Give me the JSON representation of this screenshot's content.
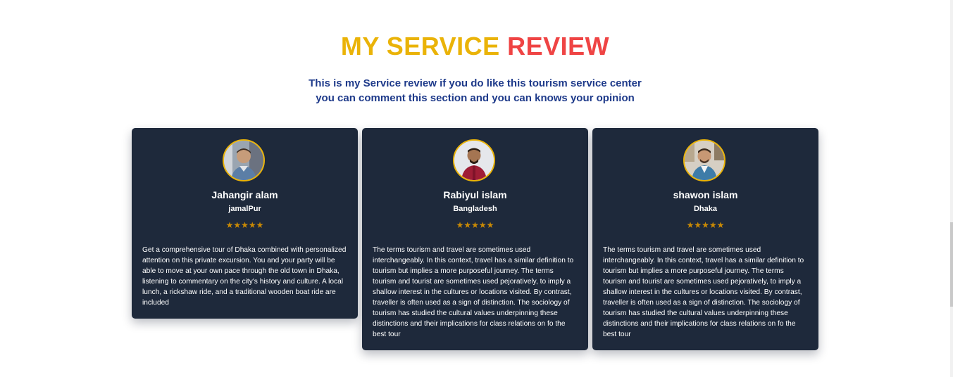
{
  "section": {
    "title_part1": "MY SERVICE",
    "title_part2": "REVIEW",
    "subtitle_line1": "This is my Service review if you do like this tourism service center",
    "subtitle_line2": "you can comment this section and you can knows your opinion"
  },
  "colors": {
    "title_accent_yellow": "#eab308",
    "title_accent_red": "#ef4444",
    "subtitle": "#1e3a8a",
    "card_background": "#1e293b",
    "star": "#ca8a04"
  },
  "reviews": [
    {
      "name": "Jahangir alam",
      "location": "jamalPur",
      "rating": 5,
      "stars": "★★★★★",
      "text": "Get a comprehensive tour of Dhaka combined with personalized attention on this private excursion. You and your party will be able to move at your own pace through the old town in Dhaka, listening to commentary on the city's history and culture. A local lunch, a rickshaw ride, and a traditional wooden boat ride are included"
    },
    {
      "name": "Rabiyul islam",
      "location": "Bangladesh",
      "rating": 5,
      "stars": "★★★★★",
      "text": "The terms tourism and travel are sometimes used interchangeably. In this context, travel has a similar definition to tourism but implies a more purposeful journey. The terms tourism and tourist are sometimes used pejoratively, to imply a shallow interest in the cultures or locations visited. By contrast, traveller is often used as a sign of distinction. The sociology of tourism has studied the cultural values underpinning these distinctions and their implications for class relations on fo the best tour"
    },
    {
      "name": "shawon islam",
      "location": "Dhaka",
      "rating": 5,
      "stars": "★★★★★",
      "text": "The terms tourism and travel are sometimes used interchangeably. In this context, travel has a similar definition to tourism but implies a more purposeful journey. The terms tourism and tourist are sometimes used pejoratively, to imply a shallow interest in the cultures or locations visited. By contrast, traveller is often used as a sign of distinction. The sociology of tourism has studied the cultural values underpinning these distinctions and their implications for class relations on fo the best tour"
    }
  ]
}
